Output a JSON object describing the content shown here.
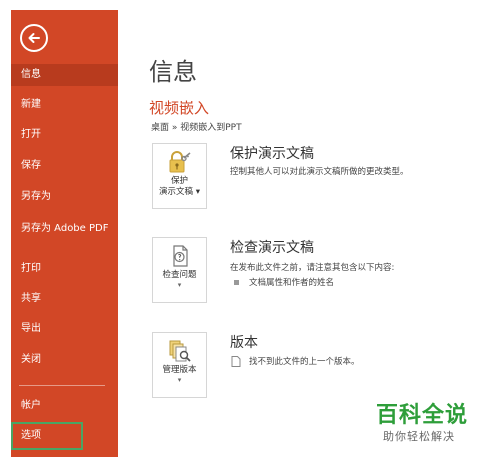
{
  "sidebar": {
    "items": [
      {
        "label": "信息"
      },
      {
        "label": "新建"
      },
      {
        "label": "打开"
      },
      {
        "label": "保存"
      },
      {
        "label": "另存为"
      },
      {
        "label": "另存为 Adobe PDF"
      },
      {
        "label": "打印"
      },
      {
        "label": "共享"
      },
      {
        "label": "导出"
      },
      {
        "label": "关闭"
      },
      {
        "label": "帐户"
      },
      {
        "label": "选项"
      }
    ]
  },
  "main": {
    "title": "信息",
    "section_title": "视频嵌入",
    "breadcrumb": "桌面 » 视频嵌入到PPT",
    "cards": [
      {
        "tile_label_1": "保护",
        "tile_label_2": "演示文稿 ▾",
        "title": "保护演示文稿",
        "description": "控制其他人可以对此演示文稿所做的更改类型。"
      },
      {
        "tile_label_1": "检查问题",
        "tile_chevron": "▾",
        "title": "检查演示文稿",
        "description": "在发布此文件之前，请注意其包含以下内容:",
        "bullet": "文档属性和作者的姓名"
      },
      {
        "tile_label_1": "管理版本",
        "tile_chevron": "▾",
        "title": "版本",
        "bullet": "找不到此文件的上一个版本。"
      }
    ]
  },
  "watermark": {
    "title": "百科全说",
    "subtitle": "助你轻松解决"
  },
  "colors": {
    "sidebar": "#d24726",
    "accent": "#d24726",
    "highlight": "#4aa564",
    "watermark": "#2e9e3a"
  },
  "icons": {
    "back": "back-arrow-icon",
    "protect": "lock-key-icon",
    "inspect": "document-check-icon",
    "versions": "versions-search-icon"
  }
}
